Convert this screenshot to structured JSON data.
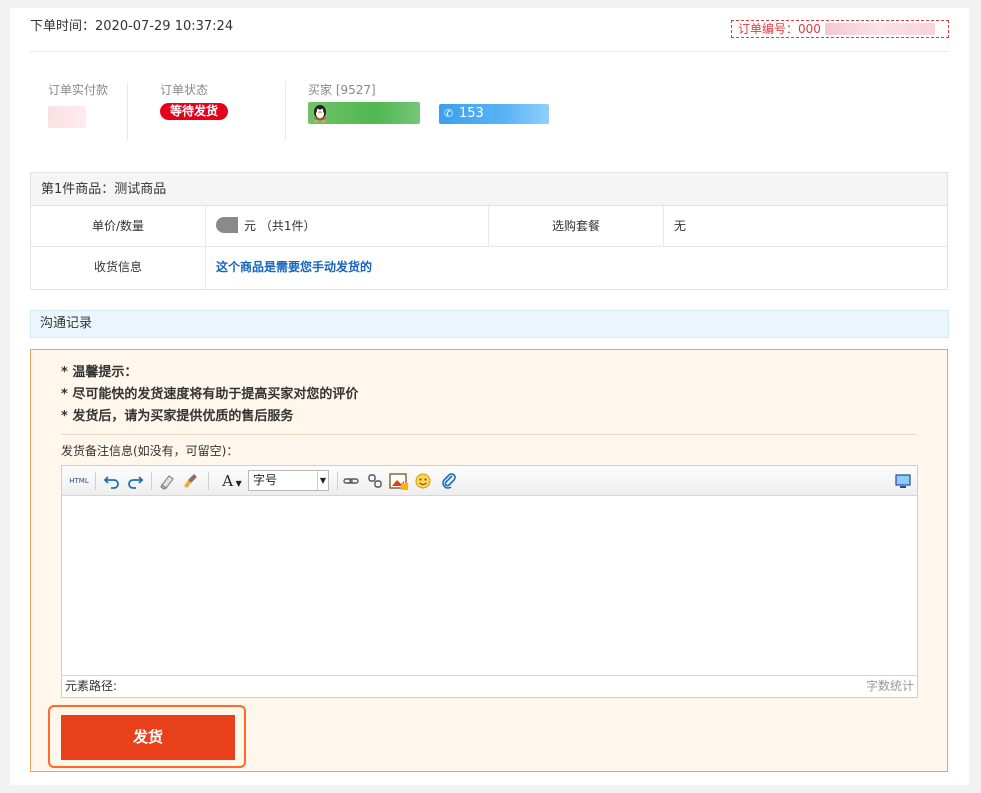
{
  "order": {
    "time_label": "下单时间：",
    "time_value": "2020-07-29 10:37:24",
    "number_label": "订单编号：000"
  },
  "summary": {
    "paid_label": "订单实付款",
    "status_label": "订单状态",
    "status_value": "等待发货",
    "buyer_label": "买家 [9527]",
    "phone_prefix": "153"
  },
  "goods": {
    "title": "第1件商品：测试商品",
    "price_label": "单价/数量",
    "price_value": "元 （共1件）",
    "package_label": "选购套餐",
    "package_value": "无",
    "delivery_label": "收货信息",
    "delivery_value": "这个商品是需要您手动发货的"
  },
  "communication": {
    "title": "沟通记录"
  },
  "tips": [
    "* 温馨提示：",
    "* 尽可能快的发货速度将有助于提高买家对您的评价",
    "* 发货后，请为买家提供优质的售后服务"
  ],
  "remark": {
    "label": "发货备注信息(如没有，可留空)："
  },
  "editor": {
    "html_label": "HTML",
    "font_glyph": "A",
    "font_size_label": "字号",
    "path_label": "元素路径:",
    "word_count_label": "字数统计"
  },
  "actions": {
    "ship_label": "发货"
  },
  "colors": {
    "accent": "#e8401a",
    "status_red": "#e4021b",
    "link_blue": "#1565c0",
    "panel_bg": "#fff6ec"
  }
}
